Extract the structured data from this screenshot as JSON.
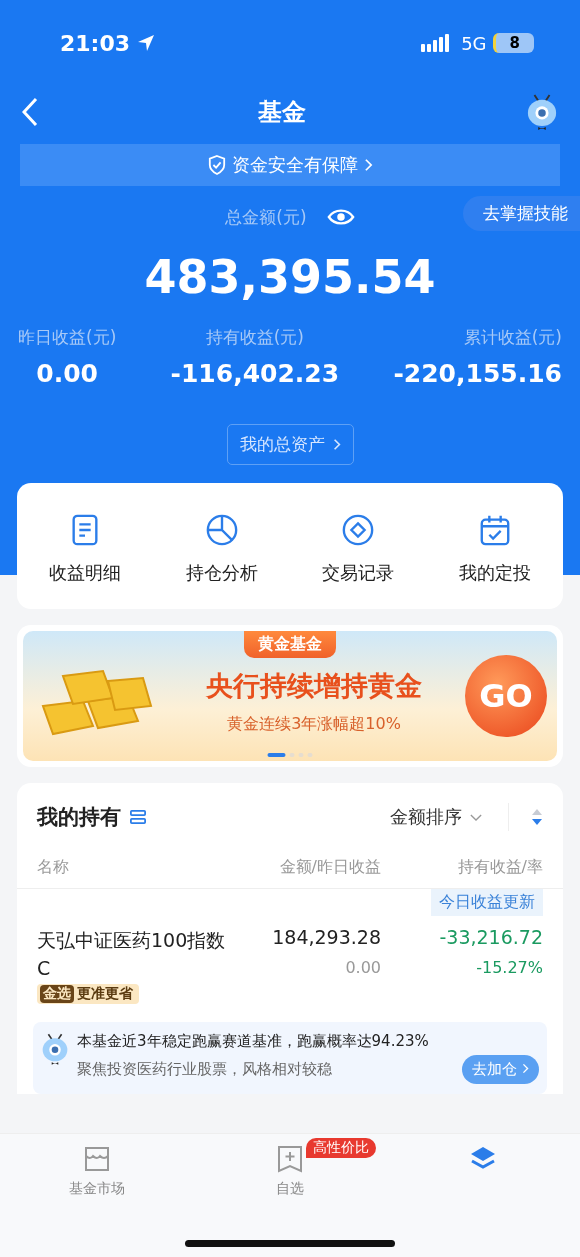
{
  "status_bar": {
    "time": "21:03",
    "network": "5G",
    "battery": "8"
  },
  "nav": {
    "title": "基金"
  },
  "safety_banner": {
    "text": "资金安全有保障"
  },
  "skill_pill": {
    "label": "去掌握技能"
  },
  "summary": {
    "total_label": "总金额(元)",
    "total": "483,395.54",
    "stats": [
      {
        "label": "昨日收益(元)",
        "value": "0.00"
      },
      {
        "label": "持有收益(元)",
        "value": "-116,402.23"
      },
      {
        "label": "累计收益(元)",
        "value": "-220,155.16"
      }
    ],
    "assets_button": "我的总资产"
  },
  "quick_actions": [
    {
      "kind": "doc",
      "label": "收益明细"
    },
    {
      "kind": "pie",
      "label": "持仓分析"
    },
    {
      "kind": "coin",
      "label": "交易记录"
    },
    {
      "kind": "calendar",
      "label": "我的定投"
    }
  ],
  "promo": {
    "tag": "黄金基金",
    "headline": "央行持续增持黄金",
    "subline": "黄金连续3年涨幅超10%",
    "go": "GO",
    "dots": [
      {
        "selected": true
      },
      {
        "selected": false
      },
      {
        "selected": false
      },
      {
        "selected": false
      }
    ]
  },
  "holdings": {
    "title": "我的持有",
    "sort": "金额排序",
    "columns": [
      "名称",
      "金额/昨日收益",
      "持有收益/率"
    ],
    "rows": [
      {
        "update_tag": "今日收益更新",
        "name": "天弘中证医药100指数C",
        "badge_mark": "金选",
        "badge_text": "更准更省",
        "amount": "184,293.28",
        "yesterday": "0.00",
        "profit": "-33,216.72",
        "rate": "-15.27%"
      }
    ],
    "tip": {
      "headline": "本基金近3年稳定跑赢赛道基准，跑赢概率达94.23%",
      "detail": "聚焦投资医药行业股票，风格相对较稳",
      "button": "去加仓"
    }
  },
  "tab_bar": [
    {
      "kind": "market",
      "label": "基金市场",
      "selected": false
    },
    {
      "kind": "watch",
      "label": "自选",
      "badge": "高性价比",
      "selected": false
    },
    {
      "kind": "holdings",
      "selected": true
    }
  ]
}
